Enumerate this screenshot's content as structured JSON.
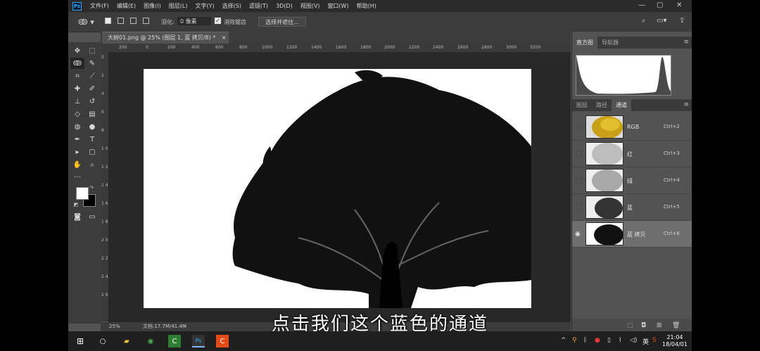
{
  "menubar": {
    "items": [
      "文件(F)",
      "编辑(E)",
      "图像(I)",
      "图层(L)",
      "文字(Y)",
      "选择(S)",
      "滤镜(T)",
      "3D(D)",
      "视图(V)",
      "窗口(W)",
      "帮助(H)"
    ],
    "logo": "Ps"
  },
  "options": {
    "feather_label": "羽化:",
    "feather_value": "0 像素",
    "antialias_label": "消除锯齿",
    "select_mask_label": "选择并遮住..."
  },
  "document": {
    "tab_title": "大树01.png @ 25% (图层 1, 蓝 拷贝/8) *",
    "ruler_top": [
      "200",
      "0",
      "200",
      "400",
      "600",
      "800",
      "1000",
      "1200",
      "1400",
      "1600",
      "1800",
      "2000",
      "2200",
      "2400",
      "2600",
      "2800",
      "3000",
      "3200"
    ],
    "ruler_left": [
      "0",
      "2",
      "4",
      "6",
      "8",
      "1 0",
      "1 2",
      "1 4",
      "1 6",
      "1 8",
      "2 0",
      "2 2",
      "2 4",
      "2 6"
    ],
    "zoom": "25%",
    "doc_info": "文档:17.7M/41.4M"
  },
  "panels": {
    "top_tabs": [
      "直方图",
      "导航器"
    ],
    "mid_tabs": [
      "图层",
      "路径",
      "通道"
    ],
    "channels": [
      {
        "name": "RGB",
        "shortcut": "Ctrl+2"
      },
      {
        "name": "红",
        "shortcut": "Ctrl+3"
      },
      {
        "name": "绿",
        "shortcut": "Ctrl+4"
      },
      {
        "name": "蓝",
        "shortcut": "Ctrl+5"
      },
      {
        "name": "蓝 拷贝",
        "shortcut": "Ctrl+6"
      }
    ]
  },
  "subtitle": "点击我们这个蓝色的通道",
  "taskbar": {
    "ime": "英",
    "time": "21:04",
    "date": "18/04/01"
  }
}
